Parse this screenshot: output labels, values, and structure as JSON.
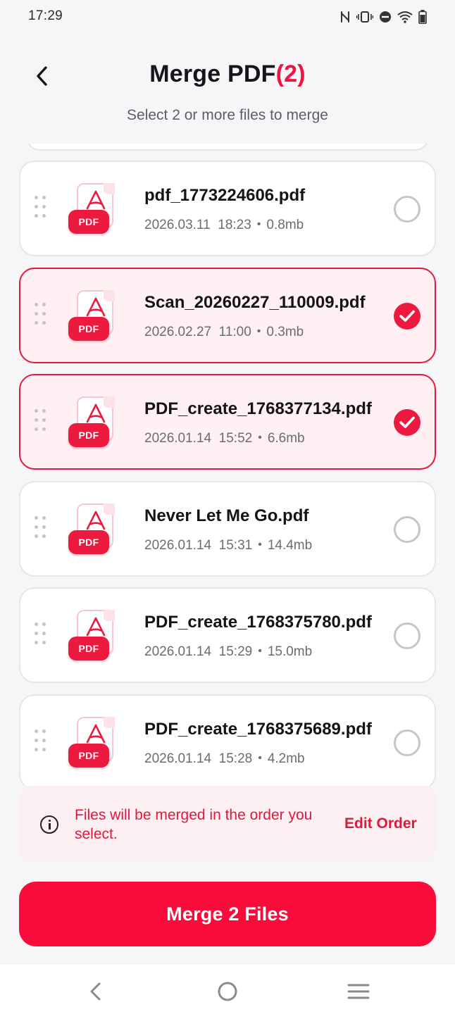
{
  "status_bar": {
    "time": "17:29",
    "icons": [
      "nfc-icon",
      "vibrate-icon",
      "do-not-disturb-icon",
      "wifi-icon",
      "battery-icon"
    ]
  },
  "header": {
    "title": "Merge PDF",
    "selected_count": "(2)",
    "subtitle": "Select 2 or more files to merge"
  },
  "files": [
    {
      "name": "pdf_1773224606.pdf",
      "date": "2026.03.11",
      "time": "18:23",
      "size": "0.8mb",
      "selected": false,
      "icon_label": "PDF"
    },
    {
      "name": "Scan_20260227_110009.pdf",
      "date": "2026.02.27",
      "time": "11:00",
      "size": "0.3mb",
      "selected": true,
      "icon_label": "PDF"
    },
    {
      "name": "PDF_create_1768377134.pdf",
      "date": "2026.01.14",
      "time": "15:52",
      "size": "6.6mb",
      "selected": true,
      "icon_label": "PDF"
    },
    {
      "name": "Never Let Me Go.pdf",
      "date": "2026.01.14",
      "time": "15:31",
      "size": "14.4mb",
      "selected": false,
      "icon_label": "PDF"
    },
    {
      "name": "PDF_create_1768375780.pdf",
      "date": "2026.01.14",
      "time": "15:29",
      "size": "15.0mb",
      "selected": false,
      "icon_label": "PDF"
    },
    {
      "name": "PDF_create_1768375689.pdf",
      "date": "2026.01.14",
      "time": "15:28",
      "size": "4.2mb",
      "selected": false,
      "icon_label": "PDF"
    }
  ],
  "meta_separator": "•",
  "info_banner": {
    "text": "Files will be merged in the order you select.",
    "action": "Edit Order"
  },
  "merge_button": {
    "label": "Merge 2 Files"
  },
  "colors": {
    "accent": "#fa0c3a",
    "selected_bg": "#fff1f3",
    "selected_border": "#e8173f",
    "banner_bg": "#fdf0f2"
  }
}
